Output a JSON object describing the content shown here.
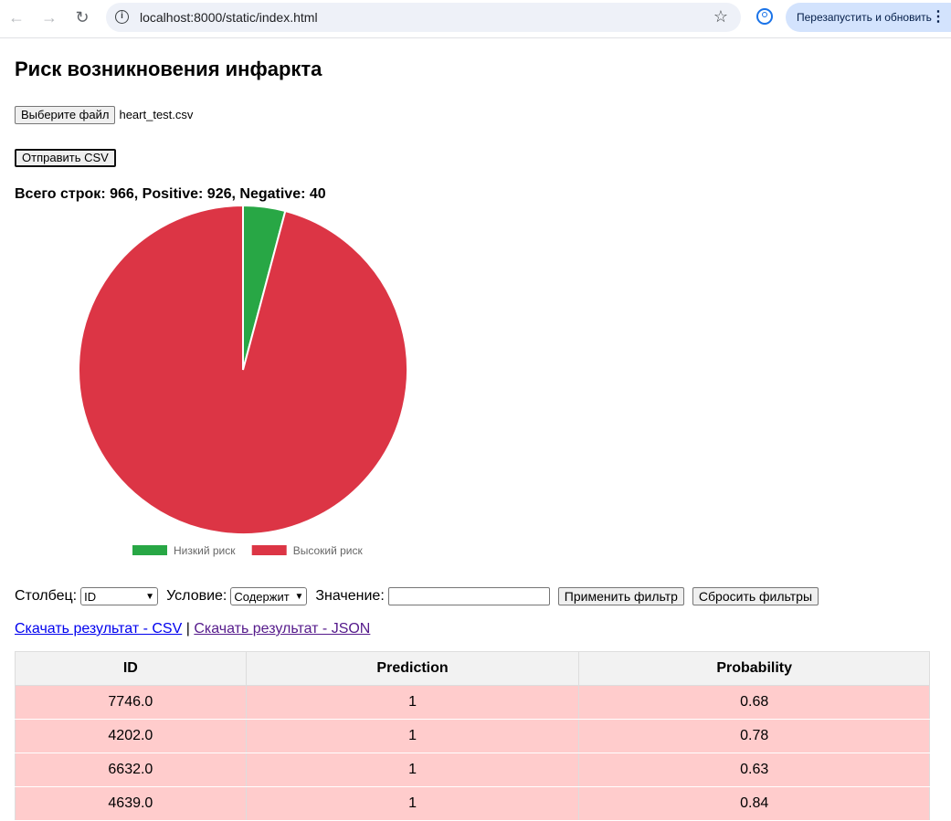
{
  "browser": {
    "url": "localhost:8000/static/index.html",
    "relaunch_label": "Перезапустить и обновить"
  },
  "page": {
    "title": "Риск возникновения инфаркта",
    "file_button": "Выберите файл",
    "file_name": "heart_test.csv",
    "send_button": "Отправить CSV",
    "summary": "Всего строк: 966, Positive: 926, Negative: 40"
  },
  "chart_data": {
    "type": "pie",
    "labels": [
      "Низкий риск",
      "Высокий риск"
    ],
    "values": [
      40,
      926
    ],
    "colors": [
      "#28a745",
      "#dc3545"
    ],
    "legend_position": "bottom"
  },
  "filter": {
    "column_label": "Столбец:",
    "column_value": "ID",
    "condition_label": "Условие:",
    "condition_value": "Содержит",
    "value_label": "Значение:",
    "value_input": "",
    "apply_button": "Применить фильтр",
    "reset_button": "Сбросить фильтры"
  },
  "links": {
    "csv": "Скачать результат - CSV",
    "separator": "|",
    "json": "Скачать результат - JSON"
  },
  "table": {
    "headers": [
      "ID",
      "Prediction",
      "Probability"
    ],
    "rows": [
      [
        "7746.0",
        "1",
        "0.68"
      ],
      [
        "4202.0",
        "1",
        "0.78"
      ],
      [
        "6632.0",
        "1",
        "0.63"
      ],
      [
        "4639.0",
        "1",
        "0.84"
      ]
    ]
  }
}
